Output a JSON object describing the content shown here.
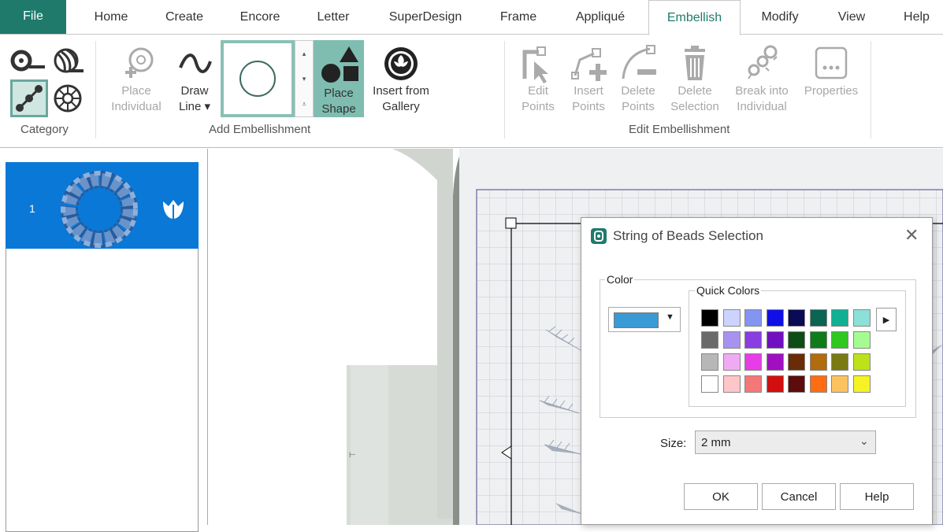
{
  "tabs": {
    "file": "File",
    "home": "Home",
    "create": "Create",
    "encore": "Encore",
    "letter": "Letter",
    "superdesign": "SuperDesign",
    "frame": "Frame",
    "applique": "Appliqué",
    "embellish": "Embellish",
    "modify": "Modify",
    "view": "View",
    "help": "Help"
  },
  "ribbon": {
    "category_label": "Category",
    "place_individual": "Place\nIndividual",
    "draw_line": "Draw\nLine ▾",
    "place_shape": "Place\nShape",
    "insert_gallery": "Insert from\nGallery",
    "add_embellishment_label": "Add Embellishment",
    "edit_points": "Edit\nPoints",
    "insert_points": "Insert\nPoints",
    "delete_points": "Delete\nPoints",
    "delete_selection": "Delete\nSelection",
    "break_individual": "Break into\nIndividual",
    "properties": "Properties",
    "edit_embellishment_label": "Edit Embellishment"
  },
  "layers": {
    "item_number": "1"
  },
  "dialog": {
    "title": "String of Beads Selection",
    "color_group": "Color",
    "quick_colors_group": "Quick Colors",
    "selected_color": "#3a9ad5",
    "size_label": "Size:",
    "size_value": "2 mm",
    "ok": "OK",
    "cancel": "Cancel",
    "help": "Help",
    "quick_colors": [
      [
        "#000000",
        "#cdd3ff",
        "#8395f0",
        "#1010e6",
        "#0a0a55",
        "#0a6552",
        "#11b094",
        "#8be0d8"
      ],
      [
        "#6a6a6a",
        "#a793ef",
        "#8a3de0",
        "#7010c0",
        "#0e4d14",
        "#0d7c19",
        "#2ec821",
        "#a6fb90"
      ],
      [
        "#b7b7b7",
        "#f0aaf3",
        "#e73de6",
        "#a010c0",
        "#6a2b07",
        "#b06c0d",
        "#7a7a12",
        "#bde11a"
      ],
      [
        "#ffffff",
        "#ffc6c9",
        "#f47878",
        "#d10f0f",
        "#5c0c0c",
        "#ff6d12",
        "#fbc35f",
        "#f6f324"
      ]
    ]
  }
}
